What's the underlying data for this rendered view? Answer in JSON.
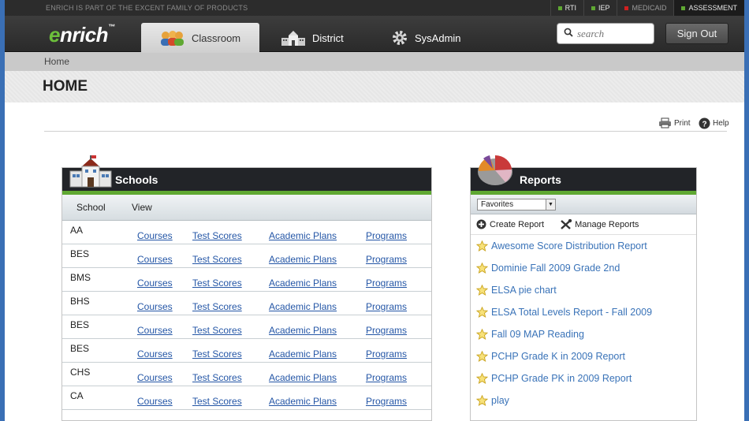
{
  "topbar": {
    "family_text": "ENRICH IS PART OF THE EXCENT FAMILY OF PRODUCTS",
    "products": [
      {
        "label": "RTI",
        "color": "#5fa832"
      },
      {
        "label": "IEP",
        "color": "#5fa832"
      },
      {
        "label": "MEDICAID",
        "color": "#d02020"
      },
      {
        "label": "ASSESSMENT",
        "color": "#5fa832"
      }
    ]
  },
  "header": {
    "logo_e": "e",
    "logo_rest": "nrich",
    "logo_mark": "™",
    "tabs": [
      {
        "label": "Classroom",
        "icon": "people-icon"
      },
      {
        "label": "District",
        "icon": "building-icon"
      },
      {
        "label": "SysAdmin",
        "icon": "gear-icon"
      }
    ],
    "search_placeholder": "search",
    "signout_label": "Sign Out"
  },
  "breadcrumb": {
    "home": "Home"
  },
  "page_title": "HOME",
  "utilities": {
    "print": "Print",
    "help": "Help"
  },
  "schools": {
    "title": "Schools",
    "col_school": "School",
    "col_view": "View",
    "link_labels": [
      "Courses",
      "Test Scores",
      "Academic Plans",
      "Programs"
    ],
    "rows": [
      "AA",
      "BES",
      "BMS",
      "BHS",
      "BES",
      "BES",
      "CHS",
      "CA"
    ]
  },
  "reports": {
    "title": "Reports",
    "filter_value": "Favorites",
    "create_label": "Create Report",
    "manage_label": "Manage Reports",
    "items": [
      "Awesome Score Distribution Report",
      "Dominie Fall 2009 Grade 2nd",
      "ELSA pie chart",
      "ELSA Total Levels Report - Fall 2009",
      "Fall 09 MAP Reading",
      "PCHP Grade K in 2009 Report",
      "PCHP Grade PK in 2009 Report",
      "play"
    ]
  },
  "colors": {
    "accent_green": "#5fa832",
    "link_blue": "#2456a6",
    "report_blue": "#3a73b8",
    "frame_blue": "#3a6fb5"
  }
}
